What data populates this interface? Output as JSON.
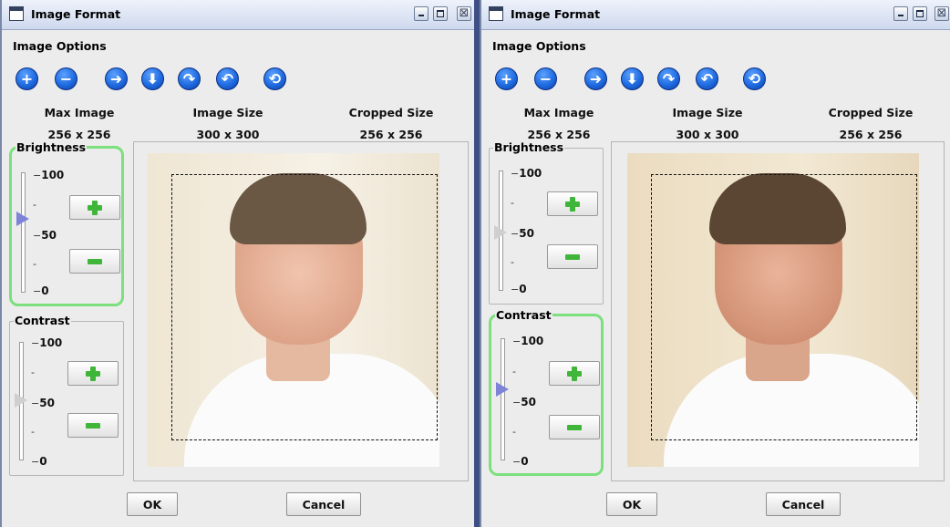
{
  "windows": [
    {
      "title": "Image Format",
      "menu": "Image Options",
      "info": {
        "headers": [
          "Max Image",
          "Image Size",
          "Cropped Size"
        ],
        "values": [
          "256 x 256",
          "300 x 300",
          "256 x 256"
        ]
      },
      "brightness": {
        "label": "Brightness",
        "ticks": [
          "100",
          "-",
          "50",
          "-",
          "0"
        ],
        "level": 0.6
      },
      "contrast": {
        "label": "Contrast",
        "ticks": [
          "100",
          "-",
          "50",
          "-",
          "0"
        ],
        "level": 0.5
      },
      "highlighted": "brightness",
      "ok_label": "OK",
      "cancel_label": "Cancel"
    },
    {
      "title": "Image Format",
      "menu": "Image Options",
      "info": {
        "headers": [
          "Max Image",
          "Image Size",
          "Cropped Size"
        ],
        "values": [
          "256 x 256",
          "300 x 300",
          "256 x 256"
        ]
      },
      "brightness": {
        "label": "Brightness",
        "ticks": [
          "100",
          "-",
          "50",
          "-",
          "0"
        ],
        "level": 0.5
      },
      "contrast": {
        "label": "Contrast",
        "ticks": [
          "100",
          "-",
          "50",
          "-",
          "0"
        ],
        "level": 0.6
      },
      "highlighted": "contrast",
      "ok_label": "OK",
      "cancel_label": "Cancel"
    }
  ],
  "toolbar_icons": [
    "zoom-in-icon",
    "zoom-out-icon",
    "move-right-icon",
    "move-down-icon",
    "rotate-right-icon",
    "rotate-left-icon",
    "reset-icon"
  ],
  "colors": {
    "highlight": "#7be07d",
    "active_thumb": "#7d84d8",
    "tool_blue": "#1f6be0"
  }
}
